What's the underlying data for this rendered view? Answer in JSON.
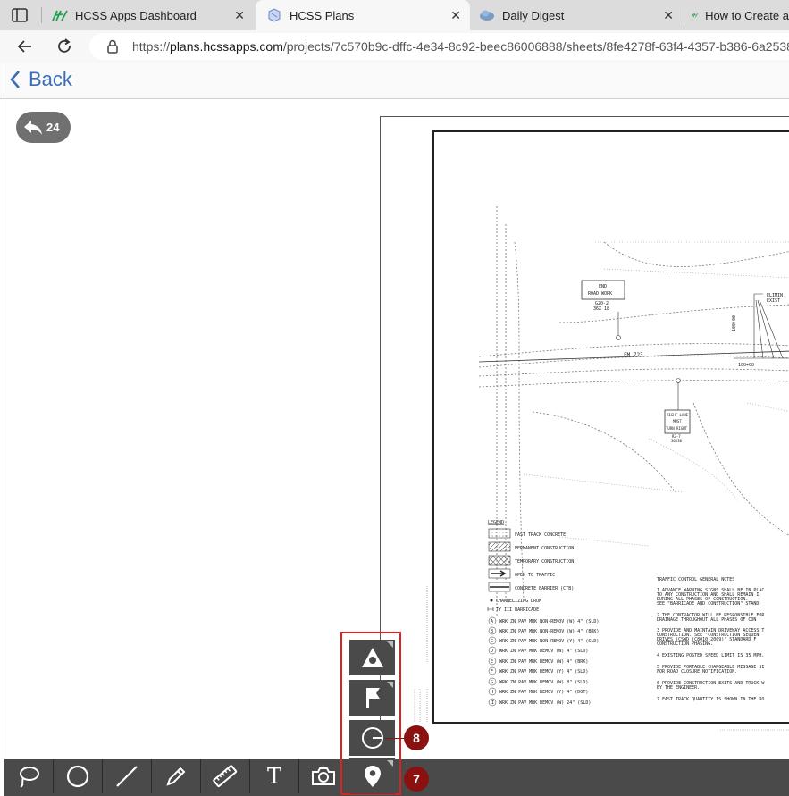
{
  "browser": {
    "tabs": [
      {
        "title": "HCSS Apps Dashboard",
        "active": false
      },
      {
        "title": "HCSS Plans",
        "active": true
      },
      {
        "title": "Daily Digest",
        "active": false
      },
      {
        "title": "How to Create a",
        "active": false
      }
    ],
    "url_scheme": "https://",
    "url_host": "plans.hcssapps.com",
    "url_path": "/projects/7c570b9c-dffc-4e34-8c92-beec86006888/sheets/8fe4278f-63f4-4357-b386-6a2538"
  },
  "app": {
    "back_label": "Back",
    "undo_count": "24",
    "accent_color": "#3b6db8"
  },
  "toolbar": {
    "tools": [
      "lasso-tool",
      "circle-tool",
      "line-tool",
      "pencil-tool",
      "ruler-tool",
      "text-tool",
      "camera-tool",
      "pin-tool"
    ],
    "text_tool_label": "T"
  },
  "flyout": {
    "items": [
      "triangle-marker-tool",
      "flag-tool",
      "circle-dash-tool",
      "pin-tool"
    ]
  },
  "callouts": {
    "upper": "8",
    "lower": "7"
  },
  "sheet": {
    "sign_end": "END",
    "sign_end2": "ROAD WORK",
    "sign_end_code": "G20-2",
    "sign_end_size": "36X 18",
    "road_label": "FM 723",
    "sign_right1": "RIGHT LANE",
    "sign_right2": "MUST",
    "sign_right3": "TURN RIGHT",
    "sign_right_code": "R3-7",
    "sign_right_size": "36X36",
    "elim_label": "ELIMIN",
    "exist_label": "EXIST",
    "station": "100+00",
    "legend_title": "LEGEND",
    "legend_items": [
      "FAST TRACK CONCRETE",
      "PERMANENT CONSTRUCTION",
      "TEMPORARY CONSTRUCTION",
      "OPEN TO TRAFFIC",
      "CONCRETE BARRIER (CTB)",
      "CHANNELIZING DRUM",
      "TY III BARRICADE"
    ],
    "marking_items": [
      {
        "key": "A",
        "text": "WRK ZN PAV MRK NON-REMOV (W) 4\" (SLD)"
      },
      {
        "key": "B",
        "text": "WRK ZN PAV MRK NON-REMOV (W) 4\" (BRK)"
      },
      {
        "key": "C",
        "text": "WRK ZN PAV MRK NON-REMOV (Y) 4\" (SLD)"
      },
      {
        "key": "D",
        "text": "WRK ZN PAV MRK REMOV (W) 4\" (SLD)"
      },
      {
        "key": "E",
        "text": "WRK ZN PAV MRK REMOV (W) 4\" (BRK)"
      },
      {
        "key": "F",
        "text": "WRK ZN PAV MRK REMOV (Y) 4\" (SLD)"
      },
      {
        "key": "G",
        "text": "WRK ZN PAV MRK REMOV (W) 8\" (SLD)"
      },
      {
        "key": "H",
        "text": "WRK ZN PAV MRK REMOV (Y) 4\" (DOT)"
      },
      {
        "key": "I",
        "text": "WRK ZN PAV MRK REMOV (W) 24\" (SLD)"
      }
    ],
    "notes_title": "TRAFFIC CONTROL GENERAL NOTES",
    "notes": [
      "1 ADVANCE WARNING SIGNS SHALL BE IN PLAC",
      "  TO ANY CONSTRUCTION AND SHALL REMAIN I",
      "  DURING ALL PHASES OF CONSTRUCTION.",
      "  SEE \"BARRICADE AND CONSTRUCTION\" STAND",
      "2 THE CONTRACTOR WILL BE RESPONSIBLE FOR",
      "  DRAINAGE THROUGHOUT ALL PHASES OF CON",
      "3 PROVIDE AND MAINTAIN DRIVEWAY ACCESS T",
      "  CONSTRUCTION. SEE \"CONSTRUCTION SEQUEN",
      "  DRIVES (CSWD (C8010-2009)\" STANDARD F",
      "  CONSTRUCTION PHASING.",
      "4 EXISTING POSTED SPEED LIMIT IS 35 MPH.",
      "5 PROVIDE PORTABLE CHANGEABLE MESSAGE SI",
      "  FOR ROAD CLOSURE NOTIFICATION.",
      "6 PROVIDE CONSTRUCTION EXITS AND TRUCK W",
      "  BY THE ENGINEER.",
      "7 FAST TRACK QUANTITY IS SHOWN IN THE RO"
    ]
  }
}
